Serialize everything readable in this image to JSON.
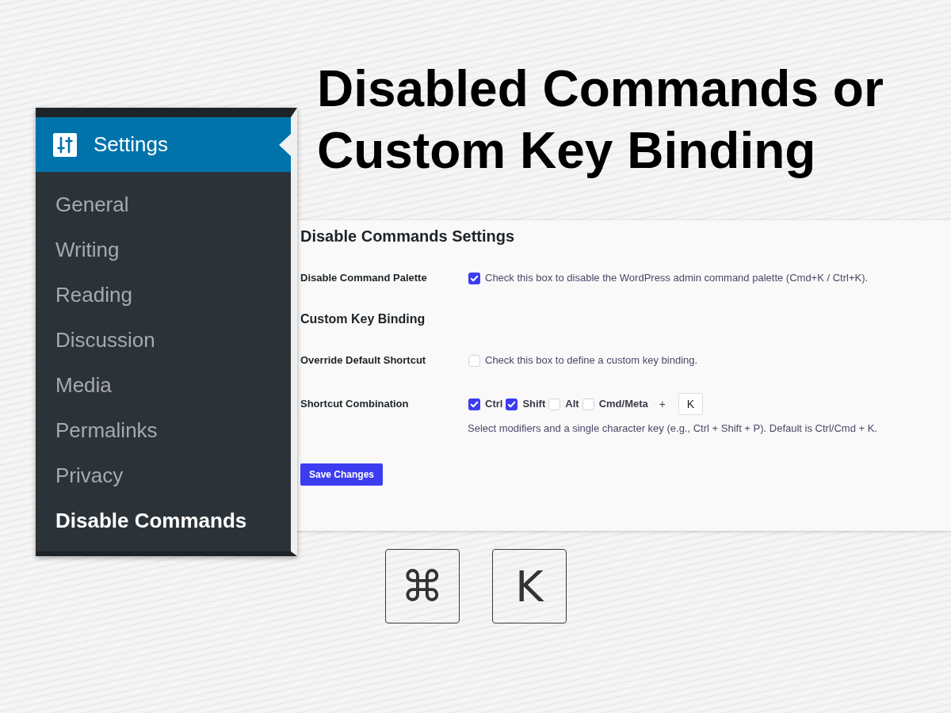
{
  "headline": "Disabled Commands or Custom Key Binding",
  "sidebar": {
    "header": {
      "label": "Settings"
    },
    "items": [
      {
        "label": "General",
        "selected": false
      },
      {
        "label": "Writing",
        "selected": false
      },
      {
        "label": "Reading",
        "selected": false
      },
      {
        "label": "Discussion",
        "selected": false
      },
      {
        "label": "Media",
        "selected": false
      },
      {
        "label": "Permalinks",
        "selected": false
      },
      {
        "label": "Privacy",
        "selected": false
      },
      {
        "label": "Disable Commands",
        "selected": true
      }
    ]
  },
  "settings_panel": {
    "title": "Disable Commands Settings",
    "rows": [
      {
        "kind": "checkbox",
        "label": "Disable Command Palette",
        "checked": true,
        "description": "Check this box to disable the WordPress admin command palette (Cmd+K / Ctrl+K)."
      },
      {
        "kind": "subheading",
        "label": "Custom Key Binding"
      },
      {
        "kind": "checkbox",
        "label": "Override Default Shortcut",
        "checked": false,
        "description": "Check this box to define a custom key binding."
      },
      {
        "kind": "shortcut",
        "label": "Shortcut Combination",
        "modifiers": [
          {
            "label": "Ctrl",
            "checked": true
          },
          {
            "label": "Shift",
            "checked": true
          },
          {
            "label": "Alt",
            "checked": false
          },
          {
            "label": "Cmd/Meta",
            "checked": false
          }
        ],
        "joiner": "+",
        "key": {
          "value": "K"
        },
        "help": "Select modifiers and a single character key (e.g., Ctrl + Shift + P). Default is Ctrl/Cmd + K."
      }
    ],
    "save_button": "Save Changes"
  },
  "keycaps": [
    "⌘",
    "K"
  ]
}
